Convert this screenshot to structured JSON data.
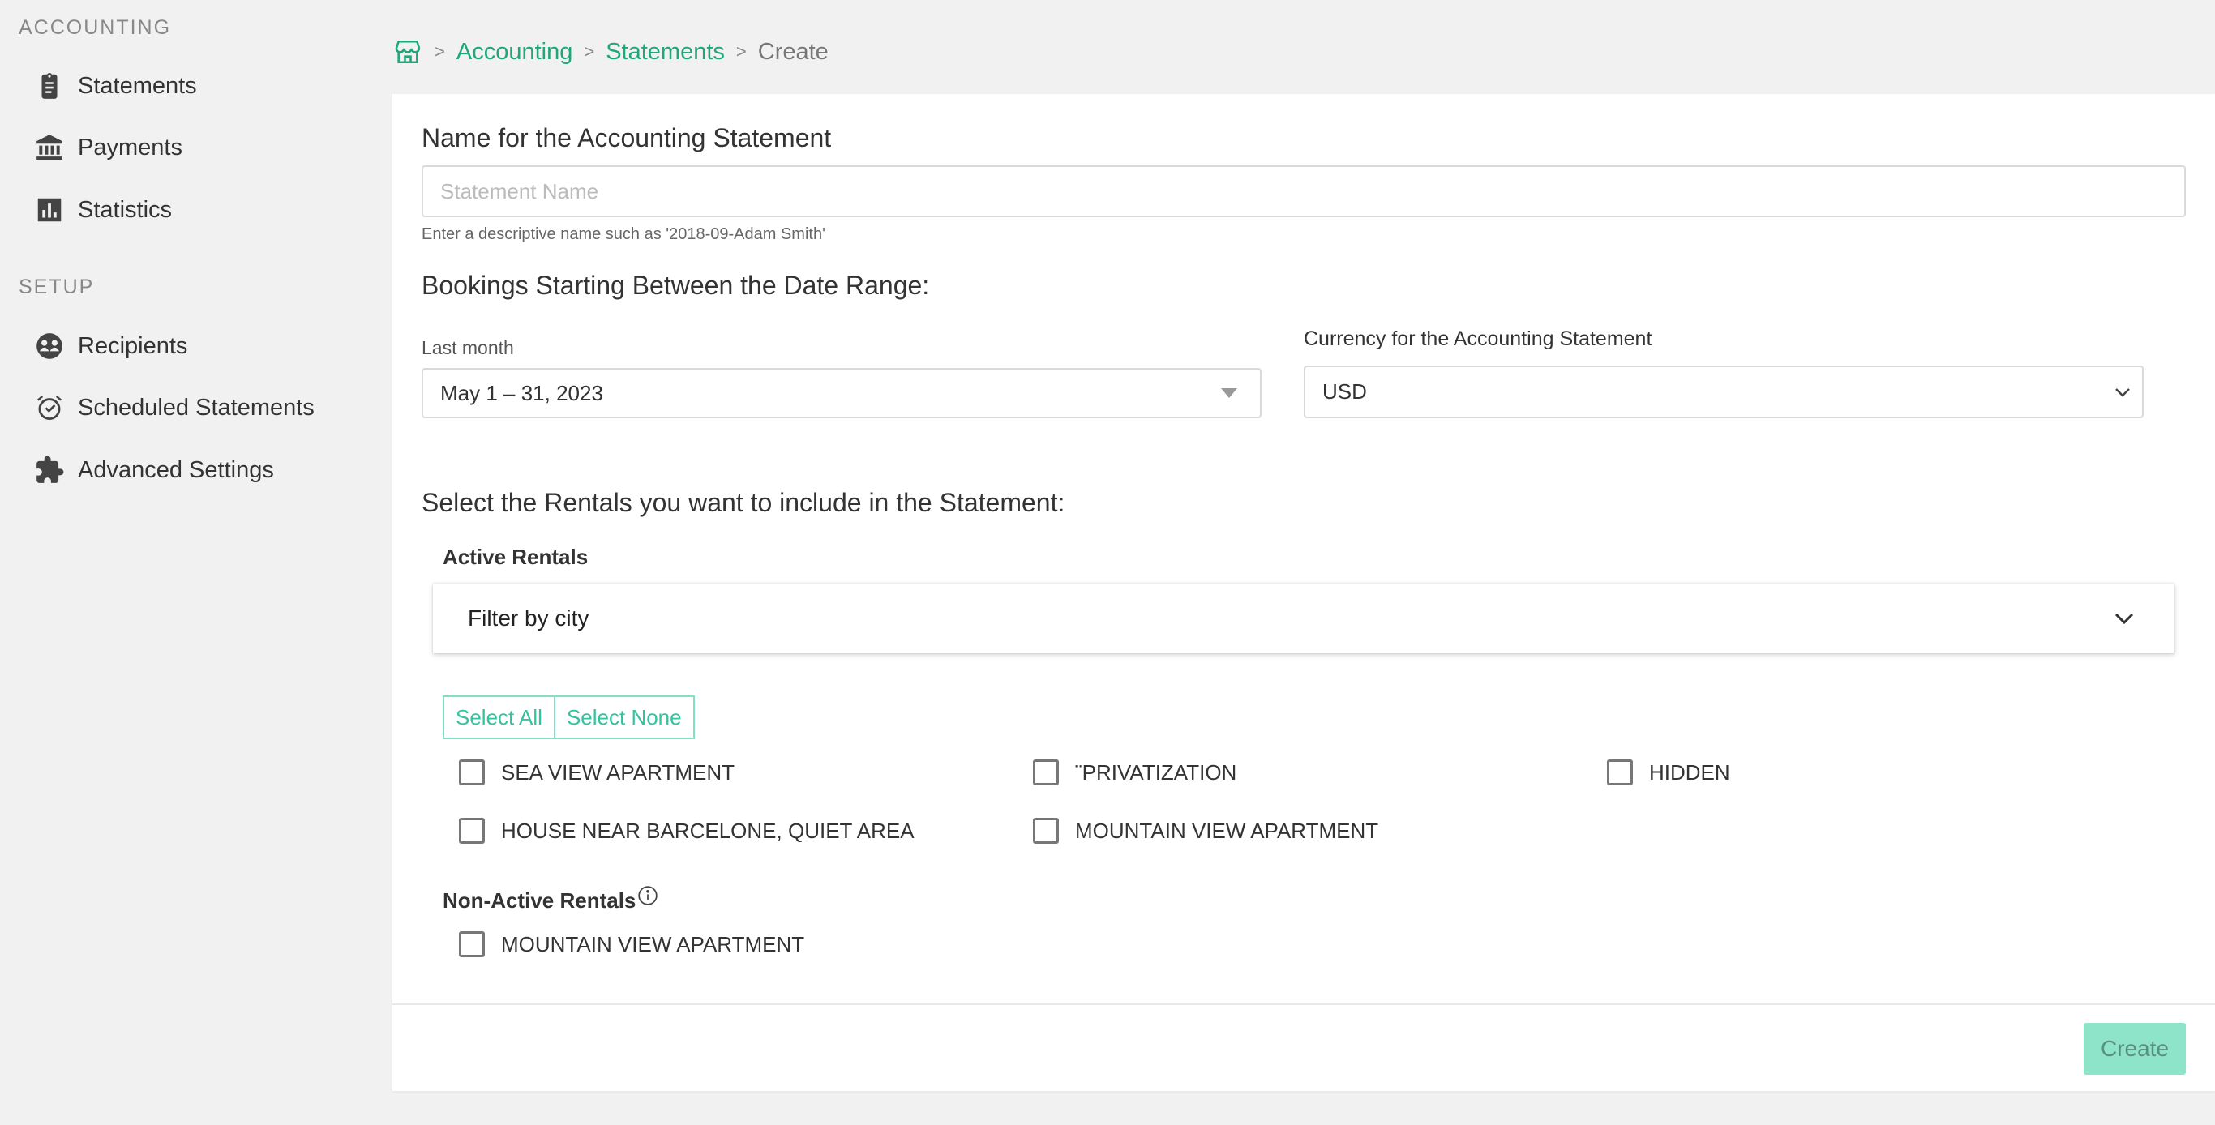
{
  "sidebar": {
    "accounting_title": "ACCOUNTING",
    "setup_title": "SETUP",
    "accounting_items": [
      {
        "label": "Statements",
        "icon": "clipboard-icon"
      },
      {
        "label": "Payments",
        "icon": "bank-icon"
      },
      {
        "label": "Statistics",
        "icon": "bar-chart-icon"
      }
    ],
    "setup_items": [
      {
        "label": "Recipients",
        "icon": "users-icon"
      },
      {
        "label": "Scheduled Statements",
        "icon": "alarm-clock-icon"
      },
      {
        "label": "Advanced Settings",
        "icon": "puzzle-icon"
      }
    ]
  },
  "breadcrumb": {
    "home_icon": "store-icon",
    "items": [
      "Accounting",
      "Statements"
    ],
    "current": "Create",
    "separator": ">"
  },
  "form": {
    "name_label": "Name for the Accounting Statement",
    "name_placeholder": "Statement Name",
    "name_value": "",
    "name_help": "Enter a descriptive name such as '2018-09-Adam Smith'",
    "date_heading": "Bookings Starting Between the Date Range:",
    "date_preset_label": "Last month",
    "date_value": "May 1 – 31, 2023",
    "currency_label": "Currency for the Accounting Statement",
    "currency_value": "USD",
    "rentals_heading": "Select the Rentals you want to include in the Statement:",
    "active_label": "Active Rentals",
    "filter_label": "Filter by city",
    "select_all": "Select All",
    "select_none": "Select None",
    "active_rentals": [
      {
        "name": "SEA VIEW APARTMENT",
        "checked": false
      },
      {
        "name": "¨PRIVATIZATION",
        "checked": false
      },
      {
        "name": "HIDDEN",
        "checked": false
      },
      {
        "name": "HOUSE NEAR BARCELONE, QUIET AREA",
        "checked": false
      },
      {
        "name": "MOUNTAIN VIEW APARTMENT",
        "checked": false
      }
    ],
    "nonactive_label": "Non-Active Rentals",
    "nonactive_rentals": [
      {
        "name": "MOUNTAIN VIEW APARTMENT",
        "checked": false
      }
    ],
    "create_button": "Create"
  },
  "colors": {
    "accent": "#1fa67a",
    "button_outline": "#7fe0c3",
    "create_disabled": "#8ee4c8",
    "background": "#f1f1f1"
  }
}
